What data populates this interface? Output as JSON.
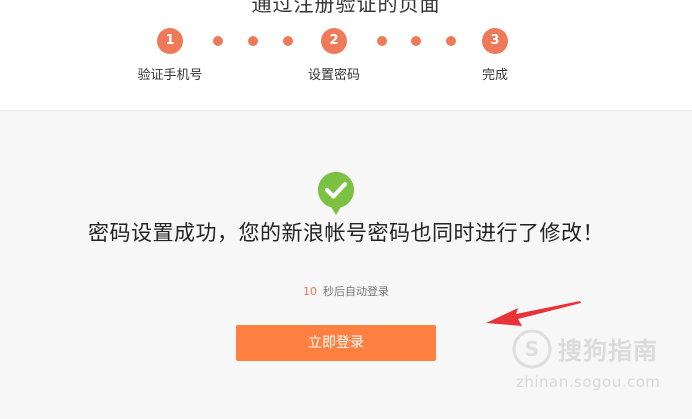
{
  "header": {
    "title_partial": "通过注册验证的页面"
  },
  "steps": [
    {
      "number": "1",
      "label": "验证手机号"
    },
    {
      "number": "2",
      "label": "设置密码"
    },
    {
      "number": "3",
      "label": "完成"
    }
  ],
  "colors": {
    "accent": "#ef7a5a",
    "button": "#ff8040",
    "success": "#7cc242",
    "arrow": "#e8333a"
  },
  "main": {
    "success_icon": "check-circle-icon",
    "message": "密码设置成功，您的新浪帐号密码也同时进行了修改！",
    "countdown_seconds": "10",
    "countdown_text": "秒后自动登录",
    "login_button_label": "立即登录"
  },
  "watermark": {
    "logo_icon": "sogou-s-icon",
    "name": "搜狗指南",
    "url": "zhinan.sogou.com"
  }
}
